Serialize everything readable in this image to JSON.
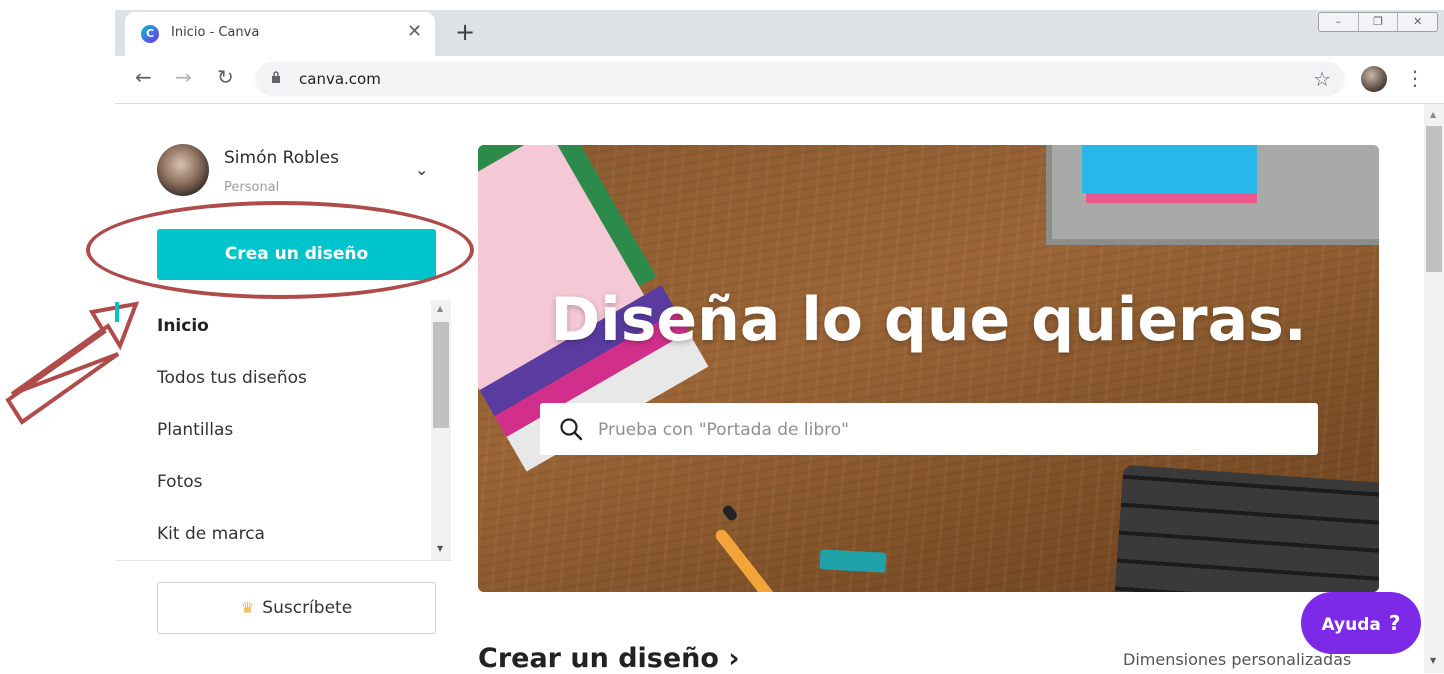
{
  "browser": {
    "tab_title": "Inicio - Canva",
    "tab_favicon": "C",
    "tab_close": "✕",
    "new_tab": "+",
    "window_controls": [
      "–",
      "❐",
      "✕"
    ],
    "url": "canva.com",
    "back": "←",
    "forward": "→",
    "reload": "↻",
    "star": "☆",
    "menu": "⋮"
  },
  "user": {
    "name": "Simón Robles",
    "plan": "Personal",
    "expand": "⌄"
  },
  "sidebar": {
    "create_button": "Crea un diseño",
    "items": [
      {
        "label": "Inicio"
      },
      {
        "label": "Todos tus diseños"
      },
      {
        "label": "Plantillas"
      },
      {
        "label": "Fotos"
      },
      {
        "label": "Kit de marca"
      }
    ],
    "subscribe_crown": "♛",
    "subscribe_label": "Suscríbete"
  },
  "hero": {
    "title": "Diseña lo que quieras.",
    "search_placeholder": "Prueba con \"Portada de libro\""
  },
  "section": {
    "title": "Crear un diseño ›",
    "custom_dimensions": "Dimensiones personalizadas"
  },
  "help": {
    "label": "Ayuda",
    "icon": "?"
  },
  "colors": {
    "primary_teal": "#00c4cc",
    "help_purple": "#7d2ae8",
    "annotation_red": "#b04b4b"
  }
}
